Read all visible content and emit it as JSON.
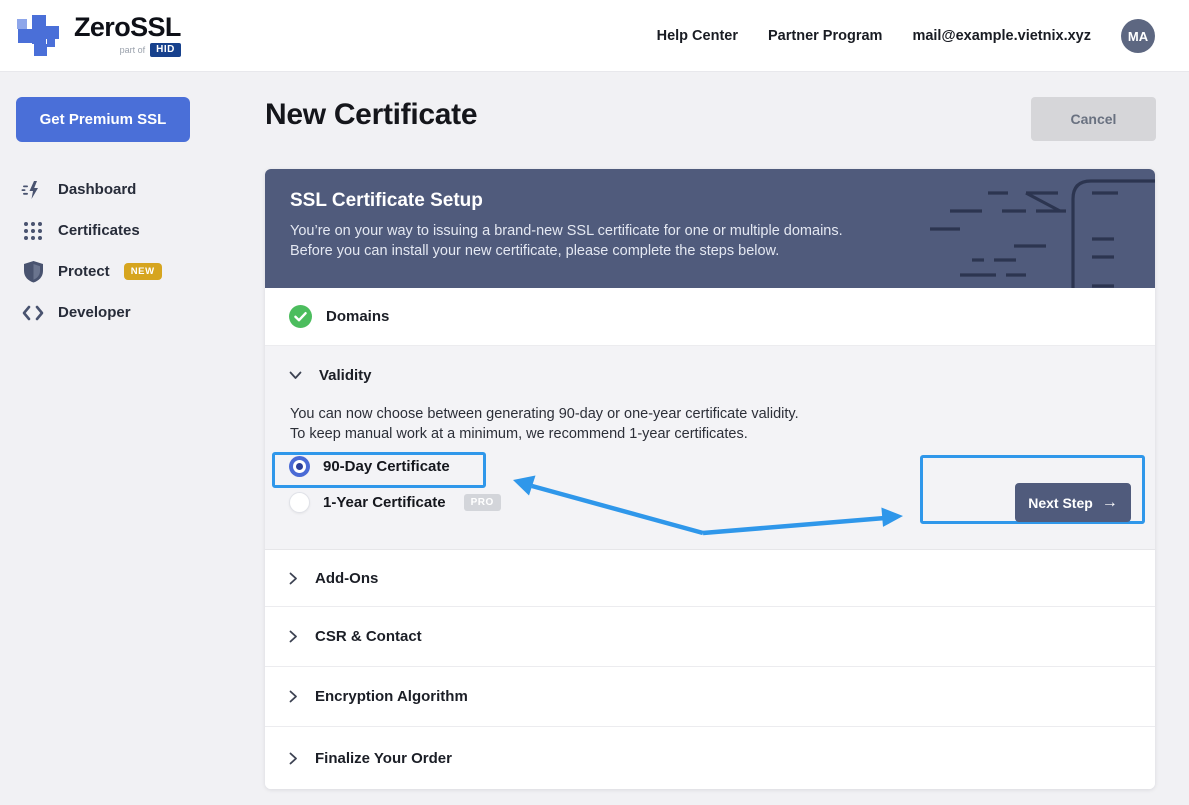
{
  "header": {
    "brand": "ZeroSSL",
    "part_of_label": "part of",
    "hid_label": "HID",
    "nav": {
      "help_center": "Help Center",
      "partner_program": "Partner Program"
    },
    "email": "mail@example.vietnix.xyz",
    "avatar_initials": "MA"
  },
  "sidebar": {
    "premium_button": "Get Premium SSL",
    "items": [
      {
        "label": "Dashboard",
        "icon": "dashboard-bolt-icon"
      },
      {
        "label": "Certificates",
        "icon": "grid-dots-icon"
      },
      {
        "label": "Protect",
        "icon": "shield-icon",
        "badge": "NEW"
      },
      {
        "label": "Developer",
        "icon": "code-brackets-icon"
      }
    ]
  },
  "page": {
    "title": "New Certificate",
    "cancel_label": "Cancel"
  },
  "wizard": {
    "header": {
      "title": "SSL Certificate Setup",
      "description_line1": "You’re on your way to issuing a brand-new SSL certificate for one or multiple domains.",
      "description_line2": "Before you can install your new certificate, please complete the steps below."
    },
    "domains_step": {
      "label": "Domains",
      "status": "complete"
    },
    "validity_step": {
      "label": "Validity",
      "description_line1": "You can now choose between generating 90-day or one-year certificate validity.",
      "description_line2": "To keep manual work at a minimum, we recommend 1-year certificates.",
      "options": [
        {
          "label": "90-Day Certificate",
          "selected": true
        },
        {
          "label": "1-Year Certificate",
          "selected": false,
          "badge": "PRO"
        }
      ],
      "next_button_label": "Next Step",
      "next_button_arrow": "→"
    },
    "collapsed_steps": [
      {
        "label": "Add-Ons"
      },
      {
        "label": "CSR & Contact"
      },
      {
        "label": "Encryption Algorithm"
      },
      {
        "label": "Finalize Your Order"
      }
    ]
  },
  "annotations": {
    "highlight_color": "#2f97ea",
    "highlighted_targets": [
      "90-day-option",
      "next-step-area"
    ]
  },
  "colors": {
    "brand_blue": "#4a6fd8",
    "slate_header": "#505b7c",
    "success_green": "#4cbd5e",
    "new_badge_yellow": "#d6a51f",
    "annotation_blue": "#2f97ea",
    "page_background": "#f1f1f4"
  }
}
